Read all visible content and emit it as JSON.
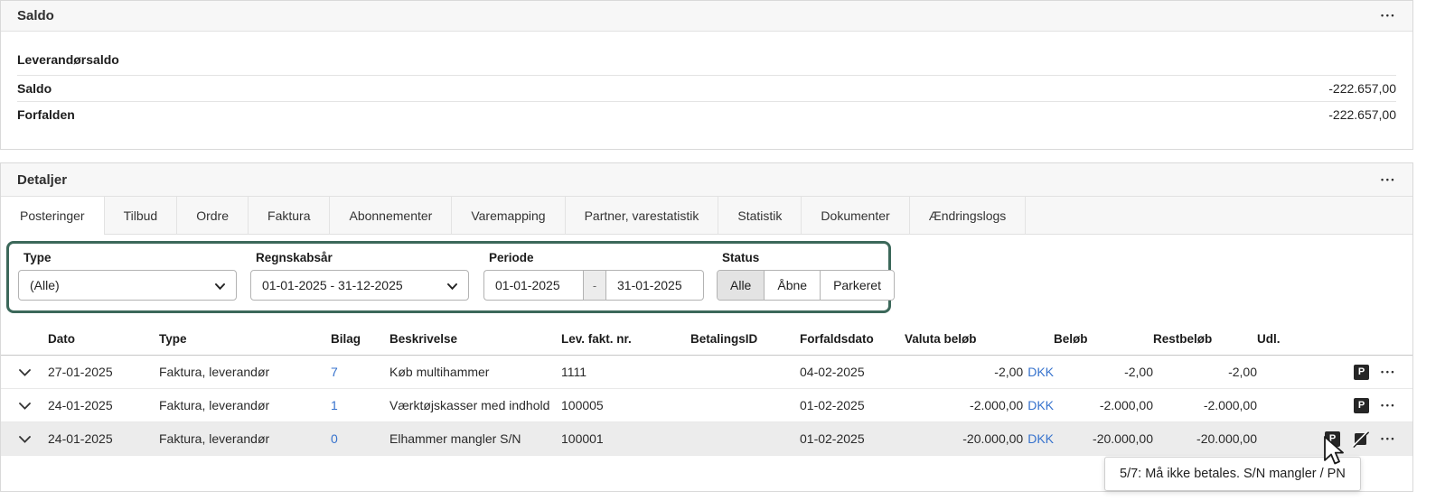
{
  "icons": {
    "more": "•••",
    "parked_label": "P"
  },
  "colors": {
    "filter_border_green": "#3c685a",
    "link_blue": "#3672cd",
    "row_highlight": "#ececec",
    "panel_header_bg": "#f7f7f7"
  },
  "saldo": {
    "title": "Saldo",
    "section_title": "Leverandørsaldo",
    "rows": [
      {
        "label": "Saldo",
        "value": "-222.657,00"
      },
      {
        "label": "Forfalden",
        "value": "-222.657,00"
      }
    ]
  },
  "detaljer": {
    "title": "Detaljer",
    "tabs": [
      "Posteringer",
      "Tilbud",
      "Ordre",
      "Faktura",
      "Abonnementer",
      "Varemapping",
      "Partner, varestatistik",
      "Statistik",
      "Dokumenter",
      "Ændringslogs"
    ],
    "active_tab": "Posteringer",
    "filters": {
      "type": {
        "label": "Type",
        "value": "(Alle)"
      },
      "fiscal_year": {
        "label": "Regnskabsår",
        "value": "01-01-2025 - 31-12-2025"
      },
      "periode": {
        "label": "Periode",
        "from": "01-01-2025",
        "separator": "-",
        "to": "31-01-2025"
      },
      "status": {
        "label": "Status",
        "options": [
          "Alle",
          "Åbne",
          "Parkeret"
        ],
        "selected": "Alle"
      }
    },
    "table": {
      "columns": [
        "Dato",
        "Type",
        "Bilag",
        "Beskrivelse",
        "Lev. fakt. nr.",
        "BetalingsID",
        "Forfaldsdato",
        "Valuta beløb",
        "Beløb",
        "Restbeløb",
        "Udl."
      ],
      "rows": [
        {
          "dato": "27-01-2025",
          "type": "Faktura, leverandør",
          "bilag": "7",
          "beskrivelse": "Køb multihammer",
          "lev_fakt_nr": "1111",
          "betalings_id": "",
          "forfaldsdato": "04-02-2025",
          "valuta_beloeb": "-2,00",
          "valuta": "DKK",
          "beloeb": "-2,00",
          "restbeloeb": "-2,00"
        },
        {
          "dato": "24-01-2025",
          "type": "Faktura, leverandør",
          "bilag": "1",
          "beskrivelse": "Værktøjskasser med indhold",
          "lev_fakt_nr": "100005",
          "betalings_id": "",
          "forfaldsdato": "01-02-2025",
          "valuta_beloeb": "-2.000,00",
          "valuta": "DKK",
          "beloeb": "-2.000,00",
          "restbeloeb": "-2.000,00"
        },
        {
          "dato": "24-01-2025",
          "type": "Faktura, leverandør",
          "bilag": "0",
          "beskrivelse": "Elhammer mangler S/N",
          "lev_fakt_nr": "100001",
          "betalings_id": "",
          "forfaldsdato": "01-02-2025",
          "valuta_beloeb": "-20.000,00",
          "valuta": "DKK",
          "beloeb": "-20.000,00",
          "restbeloeb": "-20.000,00"
        }
      ]
    },
    "tooltip": "5/7: Må ikke betales. S/N mangler / PN"
  }
}
